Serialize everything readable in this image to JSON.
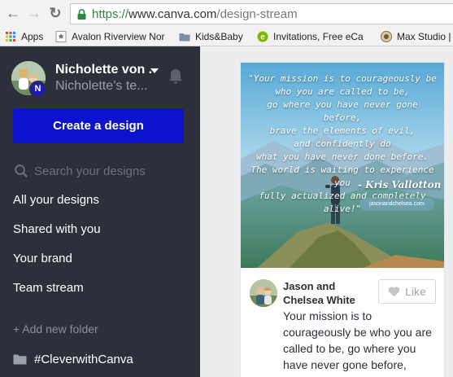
{
  "browser": {
    "back_glyph": "←",
    "forward_glyph": "→",
    "reload_glyph": "↻",
    "url": {
      "scheme": "https://",
      "host": "www.canva.com",
      "path": "/design-stream"
    },
    "lock_color": "#2a8a3b"
  },
  "bookmarks": [
    {
      "label": "Apps",
      "icon": "apps-grid-icon"
    },
    {
      "label": "Avalon Riverview Nor",
      "icon": "star-page-icon"
    },
    {
      "label": "Kids&Baby",
      "icon": "folder-icon"
    },
    {
      "label": "Invitations, Free eCa",
      "icon": "evite-icon"
    },
    {
      "label": "Max Studio |",
      "icon": "max-studio-icon"
    }
  ],
  "sidebar": {
    "user_name": "Nicholette von ...",
    "team_name": "Nicholette’s te...",
    "team_initial": "N",
    "create_label": "Create a design",
    "search_placeholder": "Search your designs",
    "nav": [
      {
        "label": "All your designs"
      },
      {
        "label": "Shared with you"
      },
      {
        "label": "Your brand"
      },
      {
        "label": "Team stream"
      }
    ],
    "add_folder_label": "+ Add new folder",
    "folder_label": "#CleverwithCanva"
  },
  "card": {
    "quote_lines": [
      "\"Your mission is to courageously be",
      "who you are called to be,",
      "go where you have never gone before,",
      "brave the elements of evil,",
      "and confidently do",
      "what you have never done before.",
      "The world is waiting to experience you",
      "fully actualized and completely alive!\""
    ],
    "attribution": "- Kris Vallotton",
    "site": "jasonandchelsea.com",
    "author": "Jason and Chelsea White",
    "like_label": "Like",
    "caption": "Your mission is to courageously be who you are called to be, go where you have never gone before,"
  },
  "colors": {
    "sidebar_bg": "#2c303a",
    "create_button": "#0c13cc",
    "content_bg": "#ecedee"
  }
}
